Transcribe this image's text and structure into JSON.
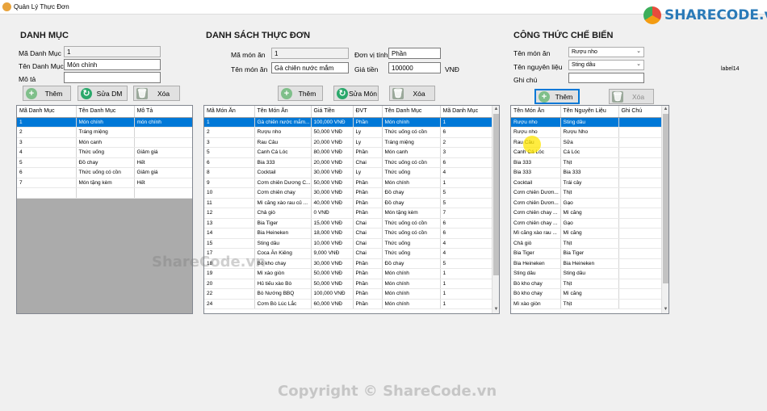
{
  "window": {
    "title": "Quản Lý Thực Đơn"
  },
  "logo": {
    "text": "SHARECODE.vn"
  },
  "watermarks": {
    "center": "ShareCode.vn",
    "bottom": "Copyright © ShareCode.vn"
  },
  "danh_muc": {
    "title": "DANH MỤC",
    "ma_label": "Mã Danh Mục",
    "ma_value": "1",
    "ten_label": "Tên Danh Mục",
    "ten_value": "Món chính",
    "mota_label": "Mô tả",
    "mota_value": "",
    "btn_them": "Thêm",
    "btn_sua": "Sửa DM",
    "btn_xoa": "Xóa",
    "columns": [
      "Mã Danh Mục",
      "Tên Danh Mục",
      "Mô Tả"
    ],
    "rows": [
      [
        "1",
        "Món chính",
        "món chính"
      ],
      [
        "2",
        "Tráng miệng",
        ""
      ],
      [
        "3",
        "Món canh",
        ""
      ],
      [
        "4",
        "Thức uống",
        "Giảm giá"
      ],
      [
        "5",
        "Đồ chay",
        "Hết"
      ],
      [
        "6",
        "Thức uống có cồn",
        "Giảm giá"
      ],
      [
        "7",
        "Món tặng kèm",
        "Hết"
      ]
    ]
  },
  "thuc_don": {
    "title": "DANH SÁCH THỰC ĐƠN",
    "ma_label": "Mã món ăn",
    "ma_value": "1",
    "ten_label": "Tên món ăn",
    "ten_value": "Gà chiên nước mắm",
    "dvt_label": "Đơn vị tính",
    "dvt_value": "Phần",
    "gia_label": "Giá tiền",
    "gia_value": "100000",
    "gia_unit": "VNĐ",
    "btn_them": "Thêm",
    "btn_sua": "Sửa Món",
    "btn_xoa": "Xóa",
    "columns": [
      "Mã Món Ăn",
      "Tên Món Ăn",
      "Giá Tiền",
      "ĐVT",
      "Tên Danh Mục",
      "Mã Danh Mục"
    ],
    "rows": [
      [
        "1",
        "Gà chiên nước mắm...",
        "100,000 VNĐ",
        "Phần",
        "Món chính",
        "1"
      ],
      [
        "2",
        "Rượu nho",
        "50,000 VNĐ",
        "Ly",
        "Thức uống có cồn",
        "6"
      ],
      [
        "3",
        "Rau Câu",
        "20,000 VNĐ",
        "Ly",
        "Tráng miệng",
        "2"
      ],
      [
        "5",
        "Canh Cá Lóc",
        "80,000 VNĐ",
        "Phần",
        "Món canh",
        "3"
      ],
      [
        "6",
        "Bia 333",
        "20,000 VNĐ",
        "Chai",
        "Thức uống có cồn",
        "6"
      ],
      [
        "8",
        "Cocktail",
        "30,000 VNĐ",
        "Ly",
        "Thức uống",
        "4"
      ],
      [
        "9",
        "Cơm chiên Dương C...",
        "50,000 VNĐ",
        "Phần",
        "Món chính",
        "1"
      ],
      [
        "10",
        "Cơm chiên chay",
        "30,000 VNĐ",
        "Phần",
        "Đồ chay",
        "5"
      ],
      [
        "11",
        "Mì căng xào rau củ ...",
        "40,000 VNĐ",
        "Phần",
        "Đồ chay",
        "5"
      ],
      [
        "12",
        "Chả giò",
        "0 VNĐ",
        "Phần",
        "Món tặng kèm",
        "7"
      ],
      [
        "13",
        "Bia Tiger",
        "15,000 VNĐ",
        "Chai",
        "Thức uống có cồn",
        "6"
      ],
      [
        "14",
        "Bia Heineken",
        "18,000 VNĐ",
        "Chai",
        "Thức uống có cồn",
        "6"
      ],
      [
        "15",
        "Sting dâu",
        "10,000 VNĐ",
        "Chai",
        "Thức uống",
        "4"
      ],
      [
        "17",
        "Coca Ăn Kiêng",
        "9,000 VNĐ",
        "Chai",
        "Thức uống",
        "4"
      ],
      [
        "18",
        "Bò kho chay",
        "30,000 VNĐ",
        "Phần",
        "Đồ chay",
        "5"
      ],
      [
        "19",
        "Mì xào giòn",
        "50,000 VNĐ",
        "Phần",
        "Món chính",
        "1"
      ],
      [
        "20",
        "Hủ tiếu xào Bò",
        "50,000 VNĐ",
        "Phần",
        "Món chính",
        "1"
      ],
      [
        "22",
        "Bò Nướng BBQ",
        "100,000 VNĐ",
        "Phần",
        "Món chính",
        "1"
      ],
      [
        "24",
        "Cơm Bò Lúc Lắc",
        "60,000 VNĐ",
        "Phần",
        "Món chính",
        "1"
      ]
    ]
  },
  "cong_thuc": {
    "title": "CÔNG THỨC CHẾ BIẾN",
    "mon_label": "Tên món ăn",
    "mon_value": "Rượu nho",
    "nl_label": "Tên nguyên liệu",
    "nl_value": "Sting dâu",
    "ghichu_label": "Ghi chú",
    "ghichu_value": "",
    "label14": "label14",
    "btn_them": "Thêm",
    "btn_xoa": "Xóa",
    "columns": [
      "Tên Món Ăn",
      "Tên Nguyên Liệu",
      "Ghi Chú"
    ],
    "rows": [
      [
        "Rượu nho",
        "Sting dâu",
        ""
      ],
      [
        "Rượu nho",
        "Rượu Nho",
        ""
      ],
      [
        "Rau Câu",
        "Sữa",
        ""
      ],
      [
        "Canh Cá Lóc",
        "Cá Lóc",
        ""
      ],
      [
        "Bia 333",
        "Thịt",
        ""
      ],
      [
        "Bia 333",
        "Bia 333",
        ""
      ],
      [
        "Cocktail",
        "Trái cây",
        ""
      ],
      [
        "Cơm chiên Dươn...",
        "Thịt",
        ""
      ],
      [
        "Cơm chiên Dươn...",
        "Gạo",
        ""
      ],
      [
        "Cơm chiên chay ...",
        "Mì căng",
        ""
      ],
      [
        "Cơm chiên chay ...",
        "Gạo",
        ""
      ],
      [
        "Mì căng xào rau ...",
        "Mì căng",
        ""
      ],
      [
        "Chả giò",
        "Thịt",
        ""
      ],
      [
        "Bia Tiger",
        "Bia Tiger",
        ""
      ],
      [
        "Bia Heineken",
        "Bia Heineken",
        ""
      ],
      [
        "Sting dâu",
        "Sting dâu",
        ""
      ],
      [
        "Bò kho chay",
        "Thịt",
        ""
      ],
      [
        "Bò kho chay",
        "Mì căng",
        ""
      ],
      [
        "Mì xào giòn",
        "Thịt",
        ""
      ]
    ]
  }
}
